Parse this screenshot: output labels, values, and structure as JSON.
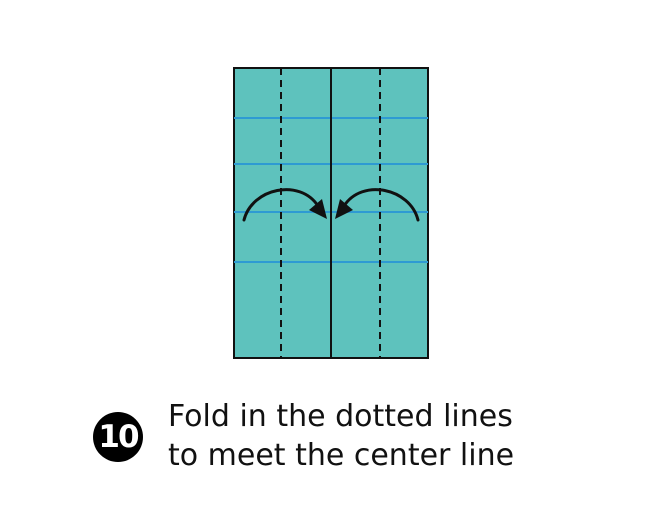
{
  "diagram": {
    "paper_color": "#5ec2bd",
    "crease_color": "#2e9ad3",
    "outline_color": "#111111",
    "arrows": [
      {
        "name": "left-fold-arrow",
        "direction": "right"
      },
      {
        "name": "right-fold-arrow",
        "direction": "left"
      }
    ]
  },
  "step": {
    "number": "10",
    "instruction_lines": [
      "Fold in the dotted lines",
      "to meet the center line"
    ]
  }
}
